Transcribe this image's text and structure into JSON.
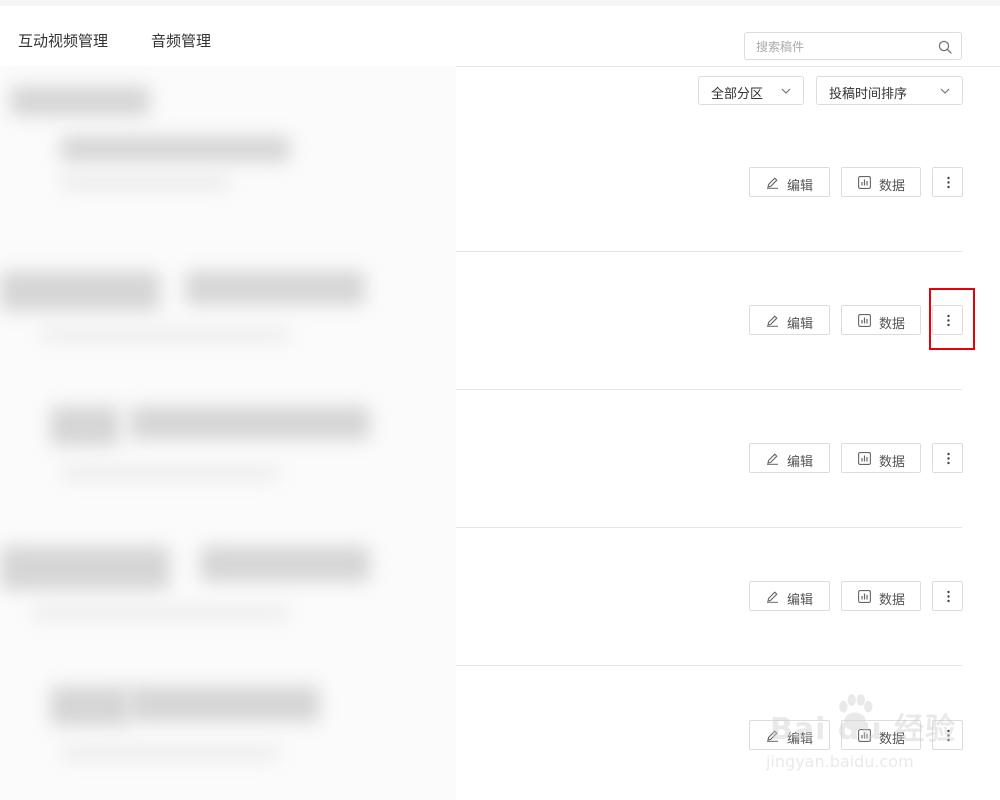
{
  "nav": {
    "tabs": [
      {
        "label": "互动视频管理"
      },
      {
        "label": "音频管理"
      }
    ]
  },
  "search": {
    "placeholder": "搜索稿件",
    "icon": "search-icon"
  },
  "filters": {
    "category": {
      "value": "全部分区"
    },
    "sort": {
      "value": "投稿时间排序"
    }
  },
  "rows": [
    {
      "edit_label": "编辑",
      "data_label": "数据"
    },
    {
      "edit_label": "编辑",
      "data_label": "数据"
    },
    {
      "edit_label": "编辑",
      "data_label": "数据"
    },
    {
      "edit_label": "编辑",
      "data_label": "数据"
    },
    {
      "edit_label": "编辑",
      "data_label": "数据"
    }
  ],
  "icons": {
    "edit": "pencil-icon",
    "data": "bar-chart-icon",
    "more": "more-vertical-icon"
  },
  "watermark": {
    "brand": "Bai du 经验",
    "url": "jingyan.baidu.com"
  },
  "colors": {
    "highlight": "#e8000b",
    "border": "#dcdcdc"
  }
}
